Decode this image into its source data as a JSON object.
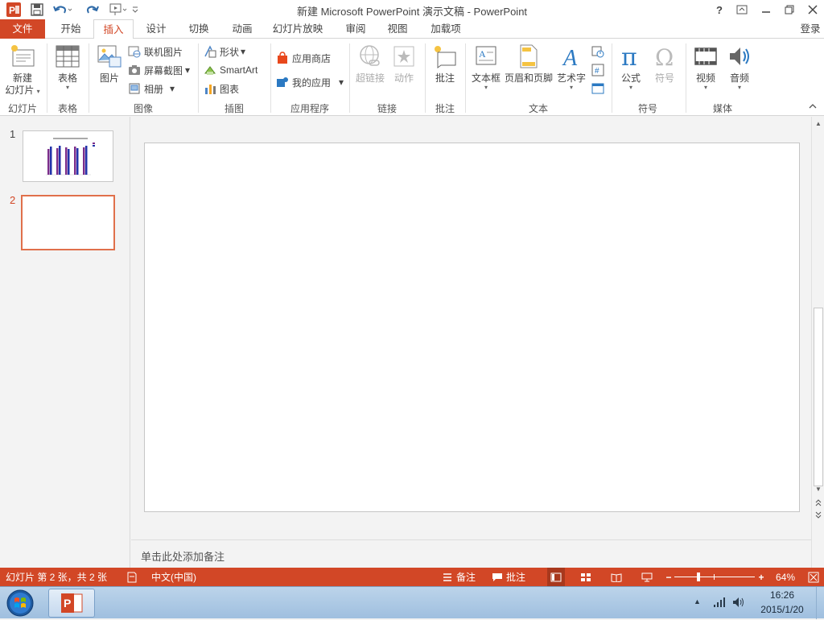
{
  "window": {
    "title": "新建 Microsoft PowerPoint 演示文稿 - PowerPoint",
    "help": "?"
  },
  "tabs": {
    "file": "文件",
    "home": "开始",
    "insert": "插入",
    "design": "设计",
    "transitions": "切换",
    "animations": "动画",
    "slideshow": "幻灯片放映",
    "review": "审阅",
    "view": "视图",
    "addins": "加载项",
    "login": "登录",
    "active": "insert",
    "accent_color": "#d24726"
  },
  "ribbon": {
    "new_slide": {
      "line1": "新建",
      "line2": "幻灯片"
    },
    "table": "表格",
    "picture": "图片",
    "online_picture": "联机图片",
    "screenshot": "屏幕截图",
    "album": "相册",
    "shapes": "形状",
    "smartart": "SmartArt",
    "chart": "图表",
    "store": "应用商店",
    "my_apps": "我的应用",
    "hyperlink": "超链接",
    "action": "动作",
    "comment": "批注",
    "textbox": "文本框",
    "header_footer": "页眉和页脚",
    "wordart": "艺术字",
    "equation": "公式",
    "symbol": "符号",
    "video": "视频",
    "audio": "音频",
    "groups": {
      "slides": "幻灯片",
      "tables": "表格",
      "images": "图像",
      "illustrations": "插图",
      "apps": "应用程序",
      "links": "链接",
      "comments": "批注",
      "text": "文本",
      "symbols": "符号",
      "media": "媒体"
    }
  },
  "thumbnails": [
    {
      "number": "1",
      "selected": false
    },
    {
      "number": "2",
      "selected": true
    }
  ],
  "notes": {
    "placeholder": "单击此处添加备注"
  },
  "statusbar": {
    "slide_info": "幻灯片 第 2 张，共 2 张",
    "language": "中文(中国)",
    "notes": "备注",
    "comments": "批注",
    "zoom": "64%",
    "zoom_fraction": 0.64
  },
  "taskbar": {
    "time": "16:26",
    "date": "2015/1/20"
  }
}
